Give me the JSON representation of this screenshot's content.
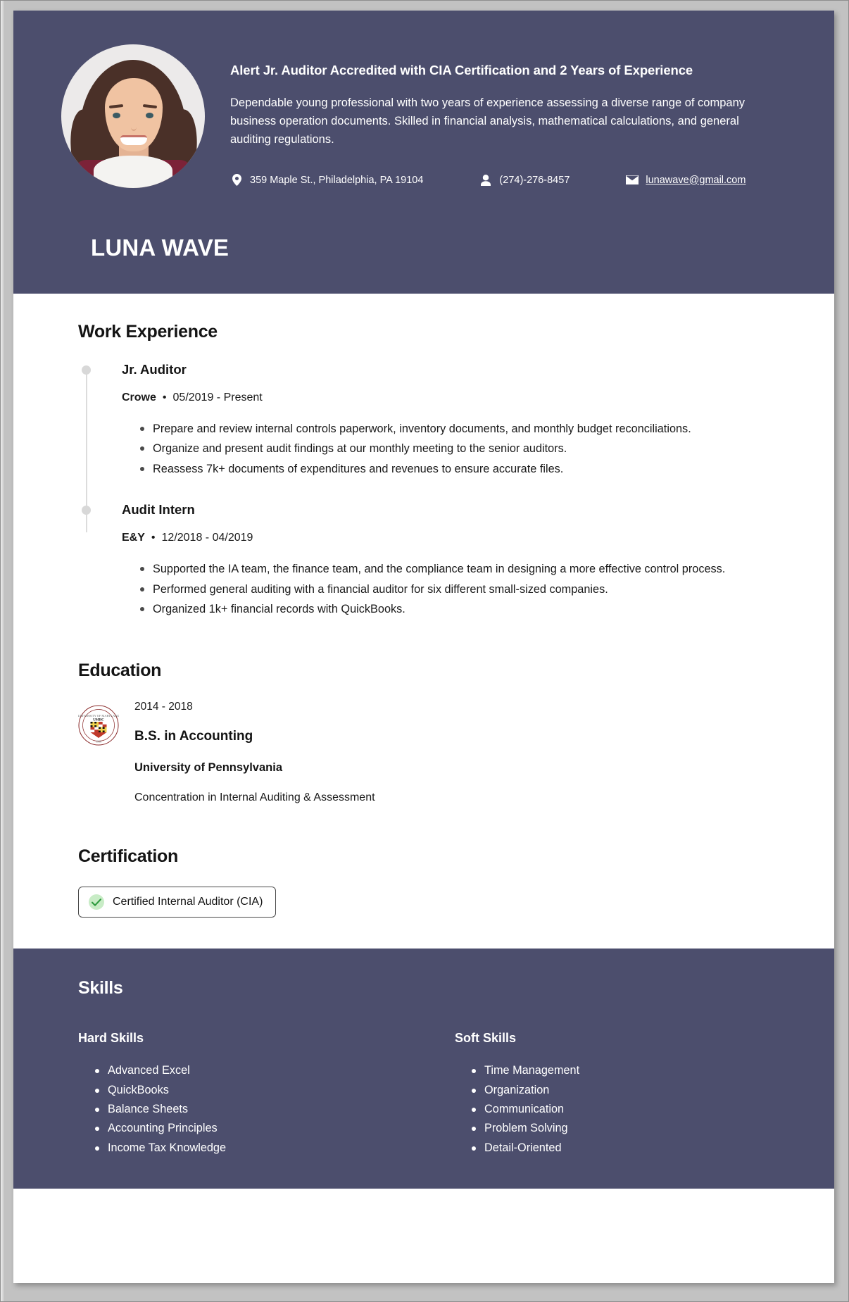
{
  "theme": {
    "navy": "#4C4E6D",
    "page_bg": "#FFFFFF",
    "frame_gray": "#C2C2C2",
    "text_dark": "#141414",
    "check_green": "#2E9B3F",
    "check_bg": "#C8ECC6"
  },
  "header": {
    "name": "LUNA WAVE",
    "headline": "Alert Jr. Auditor Accredited with CIA Certification and 2 Years of Experience",
    "summary": "Dependable young professional with two years of experience assessing a diverse range of company business operation documents. Skilled in financial analysis, mathematical calculations, and general auditing regulations.",
    "photo_alt": "portrait-photo",
    "contact": {
      "address": "359 Maple St., Philadelphia, PA 19104",
      "phone": "(274)-276-8457",
      "email": "lunawave@gmail.com",
      "address_icon": "location-pin-icon",
      "phone_icon": "person-icon",
      "email_icon": "envelope-icon"
    }
  },
  "work_experience": {
    "title": "Work Experience",
    "jobs": [
      {
        "title": "Jr. Auditor",
        "company": "Crowe",
        "separator": "•",
        "dates": "05/2019 - Present",
        "bullets": [
          "Prepare and review internal controls paperwork, inventory documents, and monthly budget reconciliations.",
          "Organize and present audit findings at our monthly meeting to the senior auditors.",
          "Reassess 7k+ documents of expenditures and revenues to ensure accurate files."
        ]
      },
      {
        "title": "Audit Intern",
        "company": "E&Y",
        "separator": "•",
        "dates": "12/2018 - 04/2019",
        "bullets": [
          "Supported the IA team, the finance team, and the compliance team in designing a more effective control process.",
          "Performed general auditing with a financial auditor for six different small-sized companies.",
          "Organized 1k+ financial records with QuickBooks."
        ]
      }
    ]
  },
  "education": {
    "title": "Education",
    "seal_alt": "university-seal-icon",
    "seal_text": "UMBC",
    "years": "2014 - 2018",
    "degree": "B.S. in Accounting",
    "school": "University of Pennsylvania",
    "concentration": "Concentration in Internal Auditing & Assessment"
  },
  "certification": {
    "title": "Certification",
    "items": [
      {
        "label": "Certified Internal Auditor (CIA)",
        "icon": "check-circle-icon"
      }
    ]
  },
  "skills": {
    "title": "Skills",
    "columns": [
      {
        "heading": "Hard Skills",
        "items": [
          "Advanced Excel",
          "QuickBooks",
          "Balance Sheets",
          "Accounting Principles",
          "Income Tax Knowledge"
        ]
      },
      {
        "heading": "Soft Skills",
        "items": [
          "Time Management",
          "Organization",
          "Communication",
          "Problem Solving",
          "Detail-Oriented"
        ]
      }
    ]
  }
}
